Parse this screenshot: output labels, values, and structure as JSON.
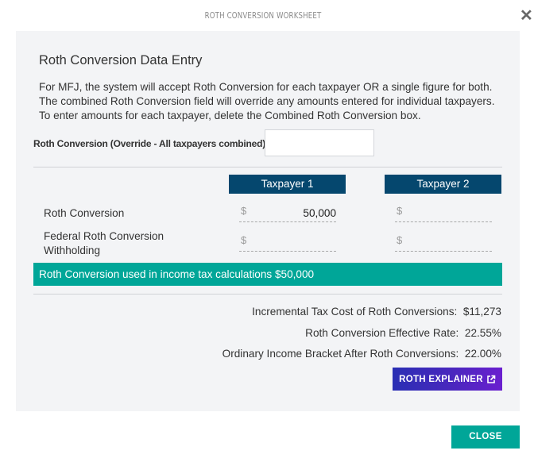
{
  "modal": {
    "title": "ROTH CONVERSION WORKSHEET",
    "close_icon": "close-x-icon",
    "close_icon_glyph": "✕",
    "close_button_label": "CLOSE"
  },
  "card": {
    "heading": "Roth Conversion Data Entry",
    "description_lines": [
      "For MFJ, the system will accept Roth Conversion for each taxpayer OR a single figure for both.",
      "The combined Roth Conversion field will override any amounts entered for individual taxpayers.",
      "To enter amounts for each taxpayer, delete the Combined Roth Conversion box."
    ],
    "override": {
      "label": "Roth Conversion (Override - All taxpayers combined)",
      "value": ""
    },
    "columns": [
      "Taxpayer 1",
      "Taxpayer 2"
    ],
    "rows": [
      {
        "label": "Roth Conversion",
        "currency_symbol": "$",
        "values": [
          "50,000",
          ""
        ]
      },
      {
        "label": "Federal Roth Conversion Withholding",
        "currency_symbol": "$",
        "values": [
          "",
          ""
        ]
      }
    ],
    "banner": "Roth Conversion used in income tax calculations $50,000",
    "summary": [
      {
        "label": "Incremental Tax Cost of Roth Conversions:",
        "value": "$11,273"
      },
      {
        "label": "Roth Conversion Effective Rate:",
        "value": "22.55%"
      },
      {
        "label": "Ordinary Income Bracket After Roth Conversions:",
        "value": "22.00%"
      }
    ],
    "explainer_button_label": "ROTH EXPLAINER",
    "explainer_icon": "external-link-icon"
  },
  "colors": {
    "header_navy": "#05476e",
    "teal": "#00a698",
    "explainer_gradient_start": "#2a2fb4",
    "explainer_gradient_end": "#6a1fcf",
    "card_bg": "#f3f4f6"
  }
}
